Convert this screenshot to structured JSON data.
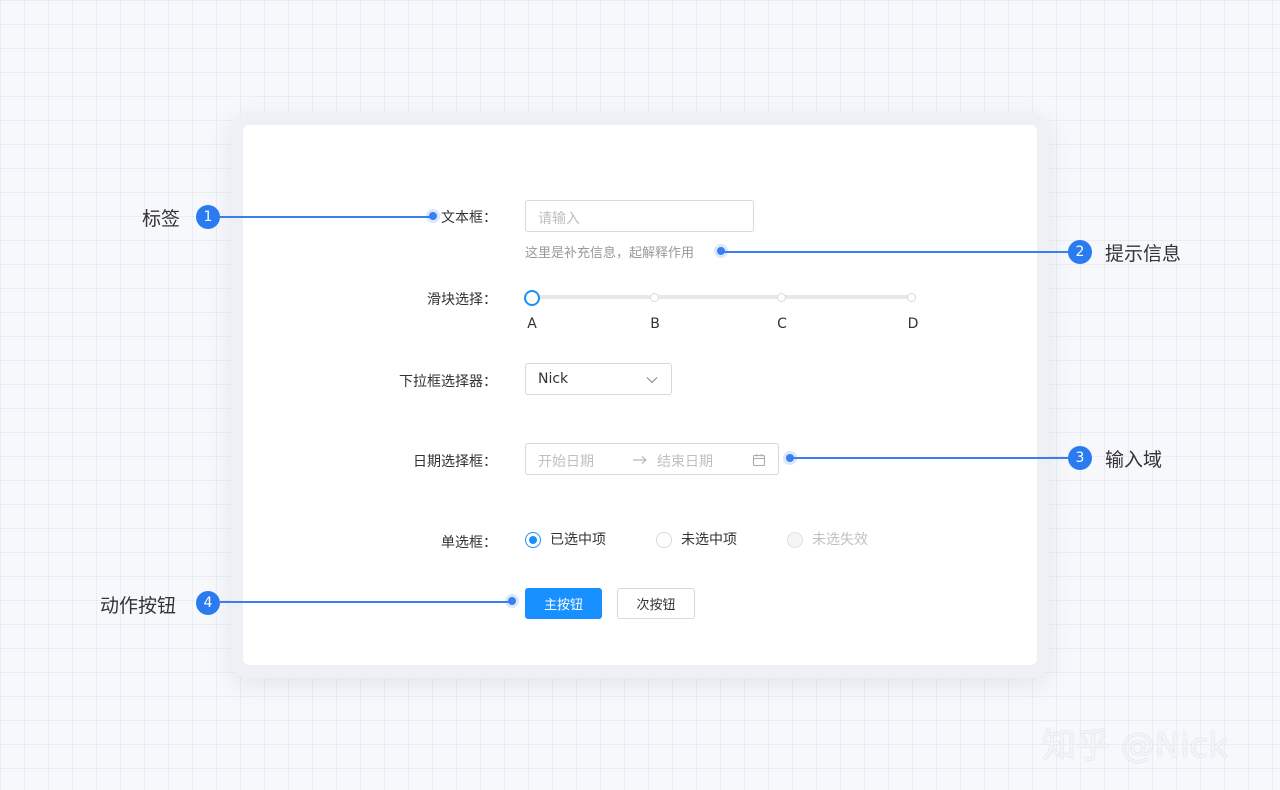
{
  "form": {
    "text_field": {
      "label": "文本框：",
      "placeholder": "请输入",
      "helper": "这里是补充信息，起解释作用"
    },
    "slider": {
      "label": "滑块选择：",
      "marks": [
        "A",
        "B",
        "C",
        "D"
      ],
      "value": "A"
    },
    "dropdown": {
      "label": "下拉框选择器：",
      "value": "Nick"
    },
    "date_range": {
      "label": "日期选择框：",
      "start_placeholder": "开始日期",
      "end_placeholder": "结束日期"
    },
    "radio": {
      "label": "单选框：",
      "options": [
        "已选中项",
        "未选中项",
        "未选失效"
      ]
    },
    "buttons": {
      "primary": "主按钮",
      "secondary": "次按钮"
    }
  },
  "annotations": [
    {
      "number": "1",
      "text": "标签"
    },
    {
      "number": "2",
      "text": "提示信息"
    },
    {
      "number": "3",
      "text": "输入域"
    },
    {
      "number": "4",
      "text": "动作按钮"
    }
  ],
  "watermark": "知乎 @Nick",
  "colors": {
    "primary": "#1890ff",
    "annotation": "#2b7bf0"
  }
}
